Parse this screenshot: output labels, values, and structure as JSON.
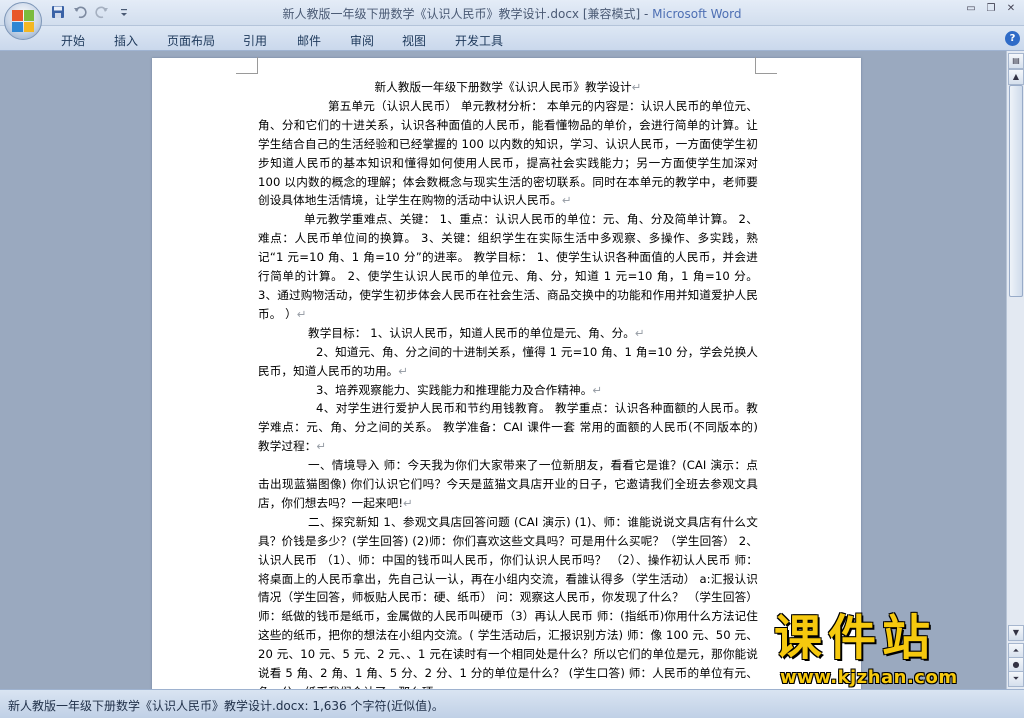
{
  "window": {
    "title_doc": "新人教版一年级下册数学《认识人民币》教学设计.docx [兼容模式] - ",
    "title_app": "Microsoft Word"
  },
  "quick_access": {
    "icons": [
      "save-icon",
      "undo-icon",
      "redo-icon",
      "customize-icon"
    ]
  },
  "ribbon": {
    "tabs": [
      "开始",
      "插入",
      "页面布局",
      "引用",
      "邮件",
      "审阅",
      "视图",
      "开发工具"
    ],
    "help_label": "?"
  },
  "document": {
    "paragraphs": [
      "新人教版一年级下册数学《认识人民币》教学设计",
      "第五单元（认识人民币） 单元教材分析： 本单元的内容是：认识人民币的单位元、角、分和它们的十进关系，认识各种面值的人民币，能看懂物品的单价，会进行简单的计算。让学生结合自己的生活经验和已经掌握的 100 以内数的知识，学习、认识人民币，一方面使学生初步知道人民币的基本知识和懂得如何使用人民币，提高社会实践能力；另一方面使学生加深对 100 以内数的概念的理解；体会数概念与现实生活的密切联系。同时在本单元的教学中，老师要创设具体地生活情境，让学生在购物的活动中认识人民币。",
      "单元教学重难点、关键： 1、重点：认识人民币的单位：元、角、分及简单计算。 2、难点：人民币单位间的换算。 3、关键：组织学生在实际生活中多观察、多操作、多实践，熟记“1 元=10 角、1 角=10 分”的进率。 教学目标： 1、使学生认识各种面值的人民币，并会进行简单的计算。 2、使学生认识人民币的单位元、角、分，知道 1 元=10 角，1 角=10 分。 3、通过购物活动，使学生初步体会人民币在社会生活、商品交换中的功能和作用并知道爱护人民币。 ）",
      "教学目标： 1、认识人民币，知道人民币的单位是元、角、分。",
      "2、知道元、角、分之间的十进制关系，懂得 1 元=10 角、1 角=10 分，学会兑换人民币，知道人民币的功用。",
      "3、培养观察能力、实践能力和推理能力及合作精神。",
      "4、对学生进行爱护人民币和节约用钱教育。 教学重点：认识各种面额的人民币。教学难点：元、角、分之间的关系。 教学准备：CAI 课件一套 常用的面额的人民币(不同版本的) 教学过程：",
      "一、情境导入 师：今天我为你们大家带来了一位新朋友，看看它是谁？(CAI 演示：点击出现蓝猫图像) 你们认识它们吗？今天是蓝猫文具店开业的日子，它邀请我们全班去参观文具店，你们想去吗？一起来吧!",
      "二、探究新知 1、参观文具店回答问题 (CAI 演示) (1)、师：谁能说说文具店有什么文具？价钱是多少？(学生回答) (2)师：你们喜欢这些文具吗？可是用什么买呢？（学生回答） 2、认识人民币 （1）、师：中国的钱币叫人民币，你们认识人民币吗？ （2）、操作初认人民币 师：将桌面上的人民币拿出，先自己认一认，再在小组内交流，看誰认得多（学生活动） a:汇报认识情况（学生回答，师板贴人民币：硬、纸币） 问：观察这人民币，你发现了什么？ （学生回答）师：纸做的钱币是纸币，金属做的人民币叫硬币（3）再认人民币 师：(指纸币)你用什么方法记住这些的纸币，把你的想法在小组内交流。( 学生活动后，汇报识别方法) 师：像 100 元、50 元、20 元、10 元、5 元、2 元、、1 元在读时有一个相同处是什么？所以它们的单位是元，那你能说说看 5 角、2 角、1 角、5 分、2 分、1 分的单位是什么？ (学生口答) 师：人民币的单位有元、角、分。纸币我们会认了，那么硬"
    ],
    "paragraph_mark": "↵"
  },
  "status_bar": {
    "text": "新人教版一年级下册数学《认识人民币》教学设计.docx: 1,636 个字符(近似值)。"
  },
  "watermark": {
    "title": "课件站",
    "url": "www.kjzhan.com"
  }
}
